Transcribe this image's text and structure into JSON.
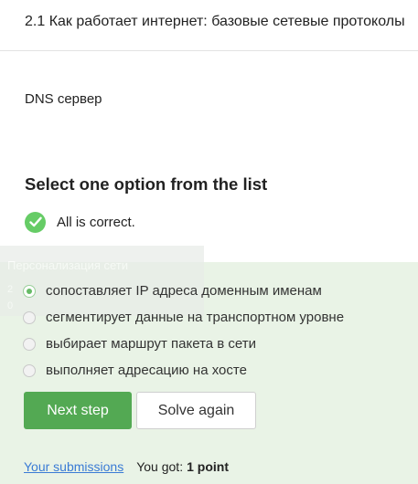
{
  "lesson": {
    "title": "2.1 Как работает интернет: базовые сетевые протоколы"
  },
  "step": {
    "text": "DNS сервер"
  },
  "quiz": {
    "title": "Select one option from the list",
    "status_icon": "check-circle-icon",
    "status_text": "All is correct.",
    "options": [
      {
        "label": "сопоставляет IP адреса доменным именам",
        "selected": true
      },
      {
        "label": "сегментирует данные на транспортном уровне",
        "selected": false
      },
      {
        "label": "выбирает маршрут пакета в сети",
        "selected": false
      },
      {
        "label": "выполняет адресацию на хосте",
        "selected": false
      }
    ],
    "next_label": "Next step",
    "solve_again_label": "Solve again"
  },
  "ghost_panel": {
    "title": "Персонализация сети",
    "line1": "2",
    "line2": "0"
  },
  "footer": {
    "submissions_label": "Your submissions",
    "result_label": "You got:",
    "result_value": "1 point"
  },
  "colors": {
    "accent_green": "#53a953",
    "correct_panel": "#e9f3e6",
    "check_green": "#66cc66",
    "link_blue": "#3a7bd5"
  }
}
